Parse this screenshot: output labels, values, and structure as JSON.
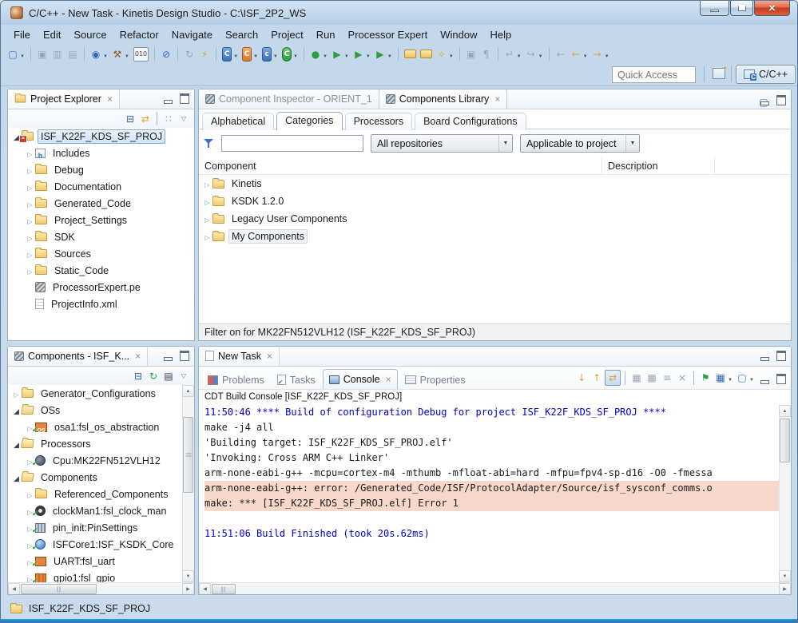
{
  "window": {
    "title": "C/C++ - New Task - Kinetis Design Studio - C:\\ISF_2P2_WS"
  },
  "menu": {
    "items": [
      {
        "label": "File"
      },
      {
        "label": "Edit"
      },
      {
        "label": "Source"
      },
      {
        "label": "Refactor"
      },
      {
        "label": "Navigate"
      },
      {
        "label": "Search"
      },
      {
        "label": "Project"
      },
      {
        "label": "Run"
      },
      {
        "label": "Processor Expert"
      },
      {
        "label": "Window"
      },
      {
        "label": "Help"
      }
    ]
  },
  "toolbar": {
    "items": [
      {
        "name": "new-wizard-button",
        "glyph": "▢",
        "ico": "c-new",
        "dd": "yes"
      },
      {
        "name": "toolbar-separator",
        "cls": "sep",
        "inter": "false"
      },
      {
        "name": "save-button",
        "glyph": "▣",
        "ico": "c-dis"
      },
      {
        "name": "save-all-button",
        "glyph": "▥",
        "ico": "c-dis"
      },
      {
        "name": "print-button",
        "glyph": "▤",
        "ico": "c-dis"
      },
      {
        "name": "toolbar-separator",
        "cls": "sep",
        "inter": "false"
      },
      {
        "name": "debug-config-button",
        "glyph": "◉",
        "ico": "c-blue",
        "dd": "yes"
      },
      {
        "name": "build-button",
        "glyph": "⚒",
        "ico": "c-brown",
        "dd": "yes"
      },
      {
        "name": "binary-view-button",
        "glyph": "010",
        "ico": "c-bin"
      },
      {
        "name": "toolbar-separator",
        "cls": "sep",
        "inter": "false"
      },
      {
        "name": "skip-breakpoints-button",
        "glyph": "⊘",
        "ico": "c-blue"
      },
      {
        "name": "toolbar-separator",
        "cls": "sep",
        "inter": "false"
      },
      {
        "name": "refresh-button",
        "glyph": "↻",
        "ico": "c-dis"
      },
      {
        "name": "pe-generate-button",
        "glyph": "⚡",
        "ico": "c-gold"
      },
      {
        "name": "toolbar-separator",
        "cls": "sep",
        "inter": "false"
      },
      {
        "name": "new-c-project-button",
        "glyph": "C",
        "ico": "c-cblue",
        "dd": "yes"
      },
      {
        "name": "new-cpp-project-button",
        "glyph": "C",
        "ico": "c-corange",
        "dd": "yes"
      },
      {
        "name": "new-c-file-button",
        "glyph": "c",
        "ico": "c-cblue2",
        "dd": "yes"
      },
      {
        "name": "new-class-button",
        "glyph": "C",
        "ico": "c-cgreen",
        "dd": "yes"
      },
      {
        "name": "toolbar-separator",
        "cls": "sep",
        "inter": "false"
      },
      {
        "name": "debug-button",
        "glyph": "●",
        "ico": "c-green",
        "dd": "yes"
      },
      {
        "name": "run-button",
        "glyph": "▶",
        "ico": "c-green",
        "dd": "yes"
      },
      {
        "name": "run-config-button",
        "glyph": "▶",
        "ico": "c-greenb",
        "dd": "yes"
      },
      {
        "name": "profile-button",
        "glyph": "▶",
        "ico": "c-greenr",
        "dd": "yes"
      },
      {
        "name": "toolbar-separator",
        "cls": "sep",
        "inter": "false"
      },
      {
        "name": "open-project-button",
        "glyph": "",
        "ico": "fold-mini"
      },
      {
        "name": "open-file-button",
        "glyph": "",
        "ico": "fold-mini"
      },
      {
        "name": "search-button",
        "glyph": "✧",
        "ico": "c-gold2",
        "dd": "yes"
      },
      {
        "name": "toolbar-separator",
        "cls": "sep",
        "inter": "false"
      },
      {
        "name": "mark-occurrences-button",
        "glyph": "▣",
        "ico": "c-dis"
      },
      {
        "name": "show-whitespace-button",
        "glyph": "¶",
        "ico": "c-dis"
      },
      {
        "name": "toolbar-separator",
        "cls": "sep",
        "inter": "false"
      },
      {
        "name": "last-edit-location-button",
        "glyph": "↵",
        "ico": "c-dis",
        "dd": "yes"
      },
      {
        "name": "go-into-button",
        "glyph": "↪",
        "ico": "c-dis",
        "dd": "yes"
      },
      {
        "name": "toolbar-separator",
        "cls": "sep",
        "inter": "false"
      },
      {
        "name": "back-disabled-button",
        "glyph": "←",
        "ico": "c-dis"
      },
      {
        "name": "back-button",
        "glyph": "←",
        "ico": "c-gold",
        "dd": "yes"
      },
      {
        "name": "forward-button",
        "glyph": "→",
        "ico": "c-gold",
        "dd": "yes"
      }
    ]
  },
  "perspective": {
    "quick_access_placeholder": "Quick Access",
    "cpp_label": "C/C++"
  },
  "project_explorer": {
    "title": "Project Explorer",
    "toolbar": [
      {
        "name": "collapse-all-button",
        "glyph": "⊟",
        "ico": "c-blue"
      },
      {
        "name": "link-with-editor-button",
        "glyph": "⇄",
        "ico": "c-gold"
      },
      {
        "name": "toolbar-separator",
        "cls": "sep",
        "inter": "false"
      },
      {
        "name": "focus-task-button",
        "glyph": "∷",
        "ico": "c-dis"
      },
      {
        "name": "view-menu-button",
        "glyph": "▽",
        "ico": "c-dim"
      }
    ],
    "tree": [
      {
        "label": "ISF_K22F_KDS_SF_PROJ",
        "arrow": "a-exp",
        "icon": "fold err",
        "cls": "lvl0 selected",
        "name": "tree-item-project-root"
      },
      {
        "label": "Includes",
        "arrow": "a-col",
        "icon": "i-includes",
        "cls": "lvl1",
        "name": "tree-item-includes"
      },
      {
        "label": "Debug",
        "arrow": "a-col",
        "icon": "fold",
        "cls": "lvl1",
        "name": "tree-item-debug"
      },
      {
        "label": "Documentation",
        "arrow": "a-col",
        "icon": "fold",
        "cls": "lvl1",
        "name": "tree-item-documentation"
      },
      {
        "label": "Generated_Code",
        "arrow": "a-col",
        "icon": "fold",
        "cls": "lvl1",
        "name": "tree-item-generated-code"
      },
      {
        "label": "Project_Settings",
        "arrow": "a-col",
        "icon": "fold",
        "cls": "lvl1",
        "name": "tree-item-project-settings"
      },
      {
        "label": "SDK",
        "arrow": "a-col",
        "icon": "fold",
        "cls": "lvl1",
        "name": "tree-item-sdk"
      },
      {
        "label": "Sources",
        "arrow": "a-col",
        "icon": "fold",
        "cls": "lvl1",
        "name": "tree-item-sources"
      },
      {
        "label": "Static_Code",
        "arrow": "a-col",
        "icon": "fold",
        "cls": "lvl1",
        "name": "tree-item-static-code"
      },
      {
        "label": "ProcessorExpert.pe",
        "arrow": "a-none",
        "icon": "i-pe",
        "cls": "lvl1",
        "name": "tree-item-processorexpert-pe"
      },
      {
        "label": "ProjectInfo.xml",
        "arrow": "a-none",
        "icon": "i-xml",
        "cls": "lvl1",
        "name": "tree-item-projectinfo-xml"
      }
    ]
  },
  "components_view": {
    "title": "Components - ISF_K...",
    "toolbar": [
      {
        "name": "collapse-all-button",
        "glyph": "⊟",
        "ico": "c-blue"
      },
      {
        "name": "generate-code-button",
        "glyph": "↻",
        "ico": "c-green"
      },
      {
        "name": "generate-pd-button",
        "glyph": "▤",
        "ico": "c-dark"
      },
      {
        "name": "view-menu-button",
        "glyph": "▽",
        "ico": "c-dim"
      }
    ],
    "tree": [
      {
        "label": "Generator_Configurations",
        "arrow": "a-col",
        "icon": "fold",
        "cls": "lvl0",
        "name": "tree-item-generator-configurations"
      },
      {
        "label": "OSs",
        "arrow": "a-exp",
        "icon": "fold fold-open",
        "cls": "lvl0",
        "name": "tree-item-oss"
      },
      {
        "label": "osa1:fsl_os_abstraction",
        "arrow": "a-col",
        "icon": "i-os chk",
        "cls": "lvl1",
        "name": "tree-item-osa1"
      },
      {
        "label": "Processors",
        "arrow": "a-exp",
        "icon": "fold fold-open",
        "cls": "lvl0",
        "name": "tree-item-processors"
      },
      {
        "label": "Cpu:MK22FN512VLH12",
        "arrow": "a-col",
        "icon": "i-cpu chk",
        "cls": "lvl1",
        "name": "tree-item-cpu"
      },
      {
        "label": "Components",
        "arrow": "a-exp",
        "icon": "fold fold-open",
        "cls": "lvl0",
        "name": "tree-item-components"
      },
      {
        "label": "Referenced_Components",
        "arrow": "a-col",
        "icon": "fold",
        "cls": "lvl1",
        "name": "tree-item-referenced-components"
      },
      {
        "label": "clockMan1:fsl_clock_man",
        "arrow": "a-col",
        "icon": "i-clock chk",
        "cls": "lvl1",
        "name": "tree-item-clockman1"
      },
      {
        "label": "pin_init:PinSettings",
        "arrow": "a-col",
        "icon": "i-pin chk",
        "cls": "lvl1",
        "name": "tree-item-pin-init"
      },
      {
        "label": "ISFCore1:ISF_KSDK_Core",
        "arrow": "a-col",
        "icon": "i-isf chk",
        "cls": "lvl1",
        "name": "tree-item-isfcore1"
      },
      {
        "label": "UART:fsl_uart",
        "arrow": "a-col",
        "icon": "i-uart chk",
        "cls": "lvl1",
        "name": "tree-item-uart"
      },
      {
        "label": "gpio1:fsl_gpio",
        "arrow": "a-col",
        "icon": "i-gpio chk",
        "cls": "lvl1",
        "name": "tree-item-gpio1"
      }
    ]
  },
  "library": {
    "tabs": [
      {
        "label": "Component Inspector - ORIENT_1",
        "cls": "inactive",
        "icon": "i-component dim",
        "x": "hide",
        "name": "tab-component-inspector"
      },
      {
        "label": "Components Library",
        "cls": "active",
        "icon": "i-component",
        "x": "show",
        "name": "tab-components-library"
      }
    ],
    "corner_buttons": [
      {
        "name": "new-component-button",
        "glyph": "▢",
        "ico": "c-new"
      },
      {
        "name": "view-menu-button",
        "glyph": "▽",
        "ico": "c-dim"
      }
    ],
    "subtabs": [
      {
        "label": "Alphabetical",
        "cls": "",
        "name": "subtab-alphabetical"
      },
      {
        "label": "Categories",
        "cls": "sel",
        "name": "subtab-categories"
      },
      {
        "label": "Processors",
        "cls": "",
        "name": "subtab-processors"
      },
      {
        "label": "Board Configurations",
        "cls": "",
        "name": "subtab-board-configurations"
      }
    ],
    "filter_value": "",
    "repo_filter": "All repositories",
    "applicable_filter": "Applicable to project",
    "col_component": "Component",
    "col_description": "Description",
    "tree": [
      {
        "label": "Kinetis",
        "arrow": "a-col",
        "icon": "fold",
        "cls": "lvl0",
        "name": "tree-item-kinetis"
      },
      {
        "label": "KSDK 1.2.0",
        "arrow": "a-col",
        "icon": "fold",
        "cls": "lvl0",
        "name": "tree-item-ksdk-120"
      },
      {
        "label": "Legacy User Components",
        "arrow": "a-col",
        "icon": "fold",
        "cls": "lvl0",
        "name": "tree-item-legacy-user-components"
      },
      {
        "label": "My Components",
        "arrow": "a-col",
        "icon": "fold",
        "cls": "lvl0 hot",
        "name": "tree-item-my-components"
      }
    ],
    "status": "Filter on for MK22FN512VLH12 (ISF_K22F_KDS_SF_PROJ)"
  },
  "editor": {
    "tab": "New Task"
  },
  "console_view": {
    "tabs": [
      {
        "label": "Problems",
        "cls": "",
        "icon": "i-problems",
        "x": "hide",
        "name": "tab-problems"
      },
      {
        "label": "Tasks",
        "cls": "",
        "icon": "i-tasks",
        "x": "hide",
        "name": "tab-tasks"
      },
      {
        "label": "Console",
        "cls": "active",
        "icon": "i-console-ico",
        "x": "show",
        "name": "tab-console"
      },
      {
        "label": "Properties",
        "cls": "",
        "icon": "i-properties",
        "x": "hide",
        "name": "tab-properties"
      }
    ],
    "toolbar": [
      {
        "name": "next-message-button",
        "glyph": "↓",
        "ico": "c-gold"
      },
      {
        "name": "previous-message-button",
        "glyph": "↑",
        "ico": "c-gold"
      },
      {
        "name": "scroll-lock-button",
        "glyph": "⇄",
        "ico": "c-gold",
        "cls": "pressed"
      },
      {
        "name": "toolbar-separator",
        "cls": "sep",
        "inter": "false"
      },
      {
        "name": "show-console-on-output-button",
        "glyph": "▦",
        "ico": "c-dis"
      },
      {
        "name": "show-console-on-error-button",
        "glyph": "▦",
        "ico": "c-dis"
      },
      {
        "name": "word-wrap-button",
        "glyph": "≡",
        "ico": "c-dis"
      },
      {
        "name": "clear-console-button",
        "glyph": "×",
        "ico": "c-dis"
      },
      {
        "name": "toolbar-separator",
        "cls": "sep",
        "inter": "false"
      },
      {
        "name": "pin-console-button",
        "glyph": "⚑",
        "ico": "c-green"
      },
      {
        "name": "display-console-button",
        "glyph": "▦",
        "ico": "c-blue",
        "dd": "yes"
      },
      {
        "name": "open-console-button",
        "glyph": "▢",
        "ico": "c-new",
        "dd": "yes"
      }
    ],
    "title": "CDT Build Console [ISF_K22F_KDS_SF_PROJ]",
    "lines": [
      {
        "text": "11:50:46 **** Build of configuration Debug for project ISF_K22F_KDS_SF_PROJ ****",
        "cls": "ln-info"
      },
      {
        "text": "make -j4 all",
        "cls": ""
      },
      {
        "text": "'Building target: ISF_K22F_KDS_SF_PROJ.elf'",
        "cls": ""
      },
      {
        "text": "'Invoking: Cross ARM C++ Linker'",
        "cls": ""
      },
      {
        "text": "arm-none-eabi-g++ -mcpu=cortex-m4 -mthumb -mfloat-abi=hard -mfpu=fpv4-sp-d16 -O0 -fmessa",
        "cls": ""
      },
      {
        "text": "arm-none-eabi-g++: error: /Generated_Code/ISF/ProtocolAdapter/Source/isf_sysconf_comms.o",
        "cls": "ln-error"
      },
      {
        "text": "make: *** [ISF_K22F_KDS_SF_PROJ.elf] Error 1",
        "cls": "ln-error"
      },
      {
        "text": "",
        "cls": ""
      },
      {
        "text": "11:51:06 Build Finished (took 20s.62ms)",
        "cls": "ln-info"
      }
    ]
  },
  "statusbar": {
    "project": "ISF_K22F_KDS_SF_PROJ"
  },
  "colors": {
    "chrome": "#c5d9ec",
    "info_text": "#0000cc",
    "error_line_bg": "#f8d8ca",
    "selection_border": "#84acdd",
    "bottom_strip": "#2c9be0"
  }
}
